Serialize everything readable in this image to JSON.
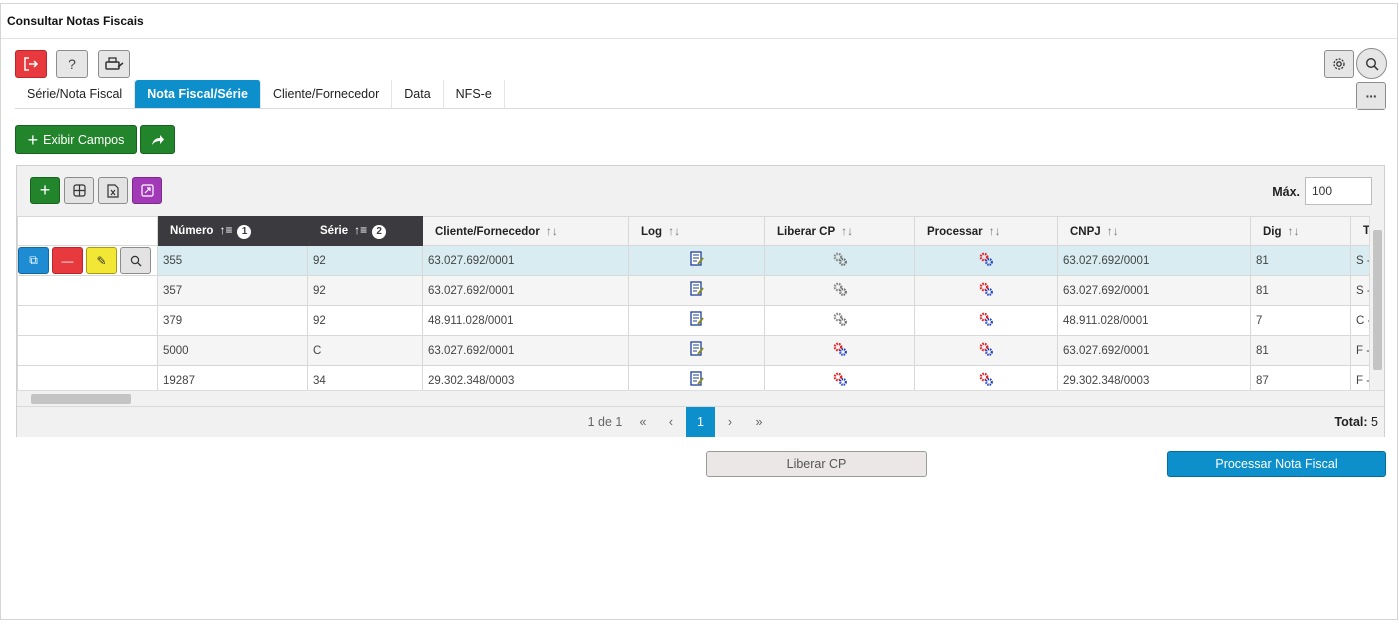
{
  "window": {
    "title": "Consultar Notas Fiscais"
  },
  "toolbar": {
    "exit_icon": "exit-icon",
    "help_label": "?",
    "print_icon": "printer-icon",
    "settings_icon": "gear-icon",
    "search_icon": "search-icon",
    "more_label": "···"
  },
  "tabs": [
    {
      "label": "Série/Nota Fiscal",
      "active": false
    },
    {
      "label": "Nota Fiscal/Série",
      "active": true
    },
    {
      "label": "Cliente/Fornecedor",
      "active": false
    },
    {
      "label": "Data",
      "active": false
    },
    {
      "label": "NFS-e",
      "active": false
    }
  ],
  "actions": {
    "show_fields_label": "Exibir Campos"
  },
  "grid": {
    "max_label": "Máx.",
    "max_value": "100",
    "columns": [
      {
        "label": "Número",
        "badge": "1"
      },
      {
        "label": "Série",
        "badge": "2"
      },
      {
        "label": "Cliente/Fornecedor"
      },
      {
        "label": "Log"
      },
      {
        "label": "Liberar CP"
      },
      {
        "label": "Processar"
      },
      {
        "label": "CNPJ"
      },
      {
        "label": "Dig"
      },
      {
        "label": "T"
      }
    ],
    "rows": [
      {
        "numero": "355",
        "serie": "92",
        "cliente": "63.027.692/0001",
        "liberar": "gray",
        "processar": "color",
        "cnpj": "63.027.692/0001",
        "dig": "81",
        "tipo": "S -"
      },
      {
        "numero": "357",
        "serie": "92",
        "cliente": "63.027.692/0001",
        "liberar": "gray",
        "processar": "color",
        "cnpj": "63.027.692/0001",
        "dig": "81",
        "tipo": "S -"
      },
      {
        "numero": "379",
        "serie": "92",
        "cliente": "48.911.028/0001",
        "liberar": "gray",
        "processar": "color",
        "cnpj": "48.911.028/0001",
        "dig": "7",
        "tipo": "C -"
      },
      {
        "numero": "5000",
        "serie": "C",
        "cliente": "63.027.692/0001",
        "liberar": "color",
        "processar": "color",
        "cnpj": "63.027.692/0001",
        "dig": "81",
        "tipo": "F -"
      },
      {
        "numero": "19287",
        "serie": "34",
        "cliente": "29.302.348/0003",
        "liberar": "color",
        "processar": "color",
        "cnpj": "29.302.348/0003",
        "dig": "87",
        "tipo": "F -"
      }
    ],
    "pager": {
      "page_info": "1 de 1",
      "first": "«",
      "prev": "‹",
      "current": "1",
      "next": "›",
      "last": "»",
      "total_label": "Total:",
      "total_value": "5"
    }
  },
  "footer": {
    "release_label": "Liberar CP",
    "process_label": "Processar Nota Fiscal"
  },
  "colors": {
    "accent": "#0d8fcb",
    "green": "#22852b",
    "red": "#e8393f",
    "purple": "#a23ab8"
  }
}
